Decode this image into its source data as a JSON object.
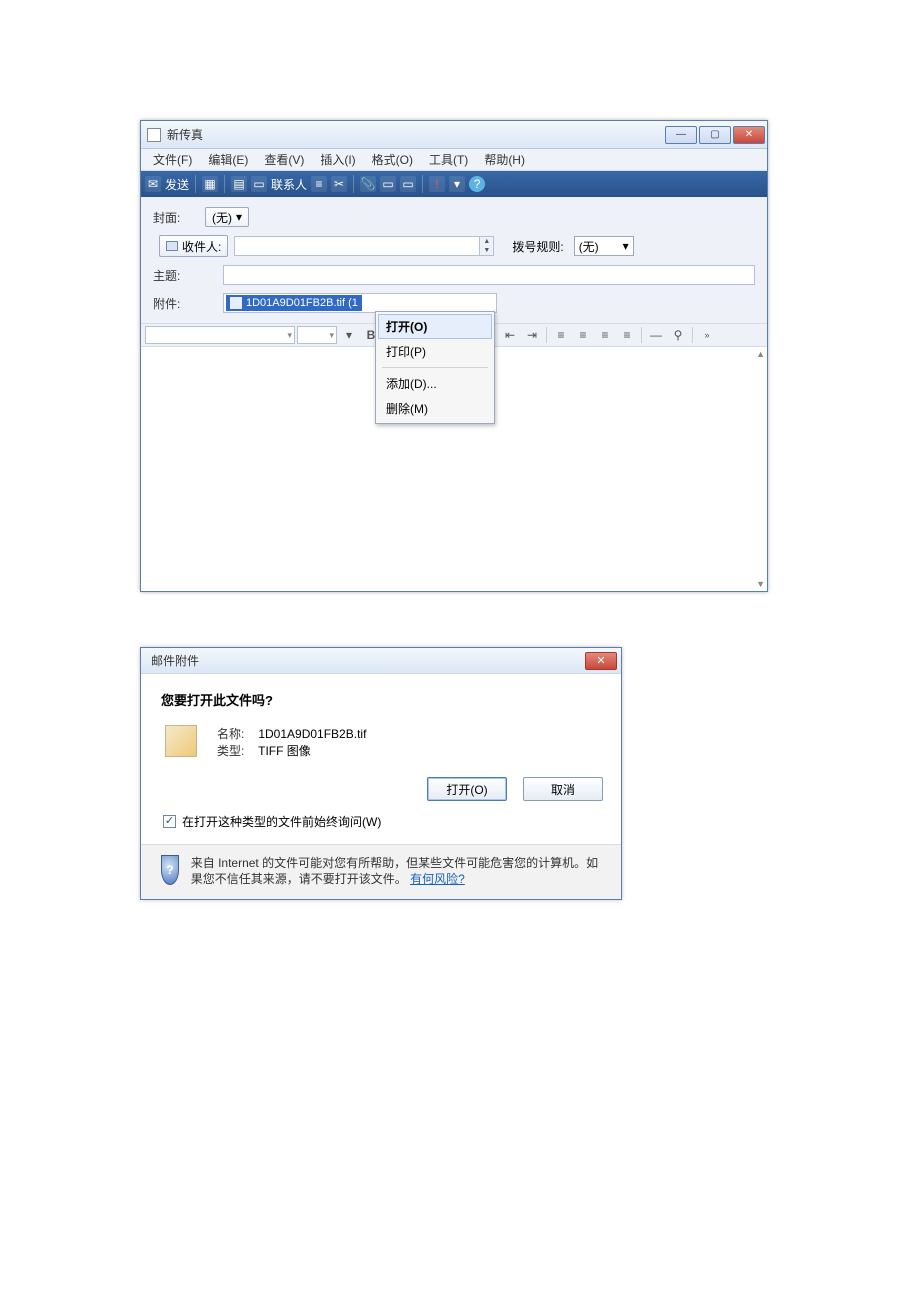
{
  "window": {
    "title": "新传真",
    "menus": [
      "文件(F)",
      "编辑(E)",
      "查看(V)",
      "插入(I)",
      "格式(O)",
      "工具(T)",
      "帮助(H)"
    ],
    "send_label": "发送",
    "contacts_label": "联系人",
    "cover_label": "封面:",
    "cover_value": "(无)",
    "recipient_btn": "收件人:",
    "rule_label": "拨号规则:",
    "rule_value": "(无)",
    "subject_label": "主题:",
    "attach_label": "附件:",
    "attachment_name": "1D01A9D01FB2B.tif (1",
    "context_menu": {
      "open": "打开(O)",
      "print": "打印(P)",
      "add": "添加(D)...",
      "delete": "删除(M)"
    }
  },
  "dialog": {
    "title": "邮件附件",
    "question": "您要打开此文件吗?",
    "name_label": "名称:",
    "name_value": "1D01A9D01FB2B.tif",
    "type_label": "类型:",
    "type_value": "TIFF 图像",
    "open_btn": "打开(O)",
    "cancel_btn": "取消",
    "always_ask": "在打开这种类型的文件前始终询问(W)",
    "warn_text": "来自 Internet 的文件可能对您有所帮助，但某些文件可能危害您的计算机。如果您不信任其来源，请不要打开该文件。",
    "risk_link": "有何风险?"
  }
}
